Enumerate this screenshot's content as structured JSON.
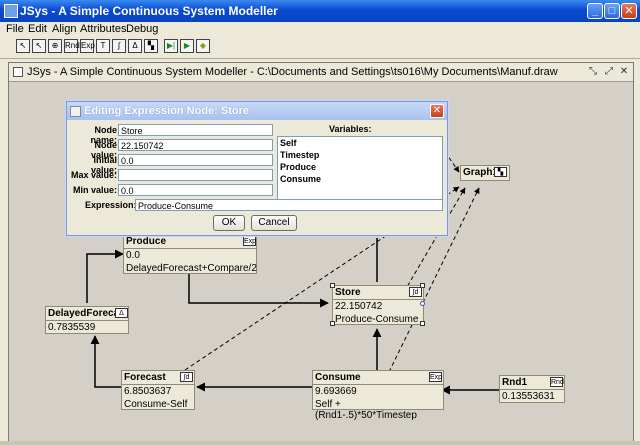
{
  "window": {
    "title": "JSys - A Simple Continuous System Modeller",
    "minimize": "_",
    "maximize": "□",
    "close": "✕"
  },
  "menu": [
    "File",
    "Edit",
    "Align",
    "Attributes",
    "Debug"
  ],
  "toolbar": [
    {
      "icon": "pointer-icon",
      "glyph": "↖"
    },
    {
      "icon": "select-icon",
      "glyph": "↖"
    },
    {
      "icon": "link-icon",
      "glyph": "⊕"
    },
    {
      "icon": "random-node-icon",
      "glyph": "Rnd"
    },
    {
      "icon": "expression-node-icon",
      "glyph": "Exp"
    },
    {
      "icon": "text-icon",
      "glyph": "T"
    },
    {
      "icon": "integral-node-icon",
      "glyph": "∫"
    },
    {
      "icon": "delay-node-icon",
      "glyph": "Δ"
    },
    {
      "icon": "graph-node-icon",
      "glyph": "▚"
    },
    {
      "icon": "run-to-icon",
      "glyph": "▶|"
    },
    {
      "icon": "run-icon",
      "glyph": "▶"
    },
    {
      "icon": "stop-icon",
      "glyph": "◆"
    }
  ],
  "inner": {
    "title": "JSys - A Simple Continuous System Modeller - C:\\Documents and Settings\\ts016\\My Documents\\Manuf.draw"
  },
  "dialog": {
    "title": "Editing Expression Node: Store",
    "fields": [
      {
        "label": "Node name:",
        "value": "Store"
      },
      {
        "label": "Node value:",
        "value": "22.150742"
      },
      {
        "label": "Initial value:",
        "value": "0.0"
      },
      {
        "label": "Max value:",
        "value": ""
      },
      {
        "label": "Min value:",
        "value": "0.0"
      }
    ],
    "variables_label": "Variables:",
    "variables": [
      "Self",
      "Timestep",
      "Produce",
      "Consume"
    ],
    "expression_label": "Expression:",
    "expression": "Produce-Consume",
    "ok": "OK",
    "cancel": "Cancel"
  },
  "nodes": {
    "graph1": {
      "name": "Graph1",
      "badge": "▚"
    },
    "produce": {
      "name": "Produce",
      "badge": "Exp",
      "value": "0.0",
      "expr": "DelayedForecast+Compare/2"
    },
    "store": {
      "name": "Store",
      "badge": "∫d",
      "value": "22.150742",
      "expr": "Produce-Consume"
    },
    "delayed": {
      "name": "DelayedForecast",
      "badge": "Δ",
      "value": "0.7835539"
    },
    "forecast": {
      "name": "Forecast",
      "badge": "∫d",
      "value": "6.8503637",
      "expr": "Consume-Self"
    },
    "consume": {
      "name": "Consume",
      "badge": "Exp",
      "value": "9.693669",
      "expr": "Self + (Rnd1-.5)*50*Timestep"
    },
    "rnd1": {
      "name": "Rnd1",
      "badge": "Rnd",
      "value": "0.13553631"
    }
  }
}
